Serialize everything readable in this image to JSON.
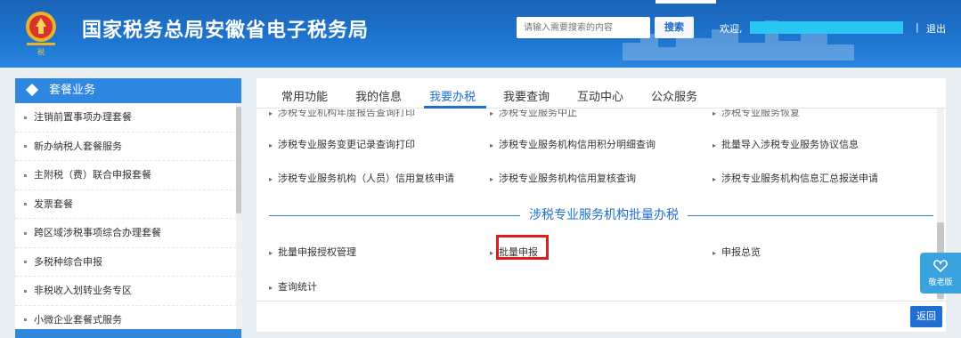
{
  "header": {
    "title": "国家税务总局安徽省电子税务局",
    "search_placeholder": "请输入需要搜索的内容",
    "search_button": "搜索",
    "welcome": "欢迎,",
    "separator": "|",
    "logout": "退出"
  },
  "sidebar": {
    "title": "套餐业务",
    "items": [
      {
        "label": "注销前置事项办理套餐"
      },
      {
        "label": "新办纳税人套餐服务"
      },
      {
        "label": "主附税（费）联合申报套餐"
      },
      {
        "label": "发票套餐"
      },
      {
        "label": "跨区域涉税事项综合办理套餐"
      },
      {
        "label": "多税种综合申报"
      },
      {
        "label": "非税收入划转业务专区"
      },
      {
        "label": "小微企业套餐式服务"
      }
    ]
  },
  "tabs": [
    {
      "label": "常用功能"
    },
    {
      "label": "我的信息"
    },
    {
      "label": "我要办税"
    },
    {
      "label": "我要查询"
    },
    {
      "label": "互动中心"
    },
    {
      "label": "公众服务"
    }
  ],
  "active_tab": "我要办税",
  "services": {
    "partial_row": [
      "涉税专业机构年度报告查询打印",
      "涉税专业服务中止",
      "涉税专业服务恢复"
    ],
    "row1": [
      "涉税专业服务变更记录查询打印",
      "涉税专业服务机构信用积分明细查询",
      "批量导入涉税专业服务协议信息"
    ],
    "row2": [
      "涉税专业服务机构（人员）信用复核申请",
      "涉税专业服务机构信用复核查询",
      "涉税专业服务机构信息汇总报送申请"
    ]
  },
  "section": {
    "title": "涉税专业服务机构批量办税",
    "row1": [
      "批量申报授权管理",
      "批量申报",
      "申报总览"
    ],
    "row2": [
      "查询统计"
    ]
  },
  "back_button": "返回",
  "elder_mode": "敬老版",
  "colors": {
    "header_blue": "#1e75d0",
    "accent": "#1e6fd0",
    "highlight_red": "#e11b1b"
  }
}
